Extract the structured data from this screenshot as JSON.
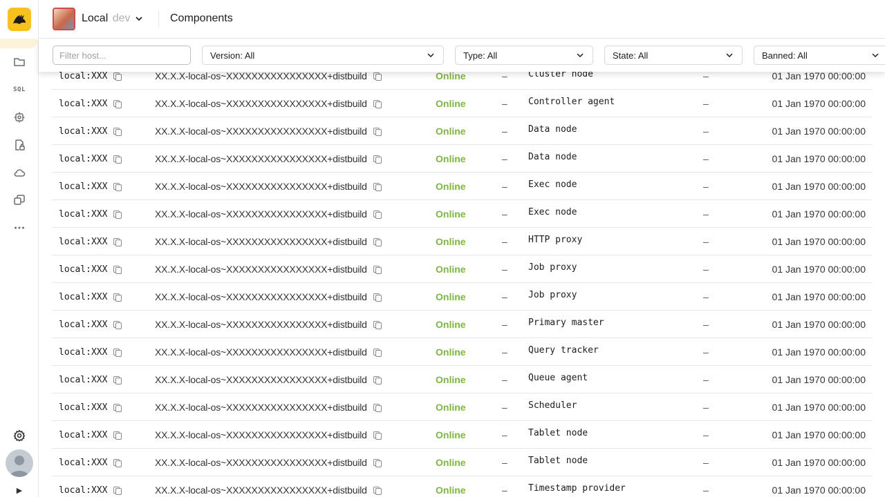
{
  "header": {
    "cluster_name": "Local",
    "cluster_env": "dev",
    "page_title": "Components"
  },
  "nav": {
    "sql_label": "SQL"
  },
  "filters": {
    "host_placeholder": "Filter host...",
    "version": "Version: All",
    "type": "Type: All",
    "state": "State: All",
    "banned": "Banned: All"
  },
  "colors": {
    "accent_logo": "#f7c21f",
    "state_online": "#7fb641"
  },
  "rows": [
    {
      "host": "local:XXX",
      "version": "XX.X.X-local-os~XXXXXXXXXXXXXXXX+distbuild",
      "state": "Online",
      "banned": "–",
      "type": "Cluster node",
      "extra": "–",
      "time": "01 Jan 1970 00:00:00"
    },
    {
      "host": "local:XXX",
      "version": "XX.X.X-local-os~XXXXXXXXXXXXXXXX+distbuild",
      "state": "Online",
      "banned": "–",
      "type": "Controller agent",
      "extra": "–",
      "time": "01 Jan 1970 00:00:00"
    },
    {
      "host": "local:XXX",
      "version": "XX.X.X-local-os~XXXXXXXXXXXXXXXX+distbuild",
      "state": "Online",
      "banned": "–",
      "type": "Data node",
      "extra": "–",
      "time": "01 Jan 1970 00:00:00"
    },
    {
      "host": "local:XXX",
      "version": "XX.X.X-local-os~XXXXXXXXXXXXXXXX+distbuild",
      "state": "Online",
      "banned": "–",
      "type": "Data node",
      "extra": "–",
      "time": "01 Jan 1970 00:00:00"
    },
    {
      "host": "local:XXX",
      "version": "XX.X.X-local-os~XXXXXXXXXXXXXXXX+distbuild",
      "state": "Online",
      "banned": "–",
      "type": "Exec node",
      "extra": "–",
      "time": "01 Jan 1970 00:00:00"
    },
    {
      "host": "local:XXX",
      "version": "XX.X.X-local-os~XXXXXXXXXXXXXXXX+distbuild",
      "state": "Online",
      "banned": "–",
      "type": "Exec node",
      "extra": "–",
      "time": "01 Jan 1970 00:00:00"
    },
    {
      "host": "local:XXX",
      "version": "XX.X.X-local-os~XXXXXXXXXXXXXXXX+distbuild",
      "state": "Online",
      "banned": "–",
      "type": "HTTP proxy",
      "extra": "–",
      "time": "01 Jan 1970 00:00:00"
    },
    {
      "host": "local:XXX",
      "version": "XX.X.X-local-os~XXXXXXXXXXXXXXXX+distbuild",
      "state": "Online",
      "banned": "–",
      "type": "Job proxy",
      "extra": "–",
      "time": "01 Jan 1970 00:00:00"
    },
    {
      "host": "local:XXX",
      "version": "XX.X.X-local-os~XXXXXXXXXXXXXXXX+distbuild",
      "state": "Online",
      "banned": "–",
      "type": "Job proxy",
      "extra": "–",
      "time": "01 Jan 1970 00:00:00"
    },
    {
      "host": "local:XXX",
      "version": "XX.X.X-local-os~XXXXXXXXXXXXXXXX+distbuild",
      "state": "Online",
      "banned": "–",
      "type": "Primary master",
      "extra": "–",
      "time": "01 Jan 1970 00:00:00"
    },
    {
      "host": "local:XXX",
      "version": "XX.X.X-local-os~XXXXXXXXXXXXXXXX+distbuild",
      "state": "Online",
      "banned": "–",
      "type": "Query tracker",
      "extra": "–",
      "time": "01 Jan 1970 00:00:00"
    },
    {
      "host": "local:XXX",
      "version": "XX.X.X-local-os~XXXXXXXXXXXXXXXX+distbuild",
      "state": "Online",
      "banned": "–",
      "type": "Queue agent",
      "extra": "–",
      "time": "01 Jan 1970 00:00:00"
    },
    {
      "host": "local:XXX",
      "version": "XX.X.X-local-os~XXXXXXXXXXXXXXXX+distbuild",
      "state": "Online",
      "banned": "–",
      "type": "Scheduler",
      "extra": "–",
      "time": "01 Jan 1970 00:00:00"
    },
    {
      "host": "local:XXX",
      "version": "XX.X.X-local-os~XXXXXXXXXXXXXXXX+distbuild",
      "state": "Online",
      "banned": "–",
      "type": "Tablet node",
      "extra": "–",
      "time": "01 Jan 1970 00:00:00"
    },
    {
      "host": "local:XXX",
      "version": "XX.X.X-local-os~XXXXXXXXXXXXXXXX+distbuild",
      "state": "Online",
      "banned": "–",
      "type": "Tablet node",
      "extra": "–",
      "time": "01 Jan 1970 00:00:00"
    },
    {
      "host": "local:XXX",
      "version": "XX.X.X-local-os~XXXXXXXXXXXXXXXX+distbuild",
      "state": "Online",
      "banned": "–",
      "type": "Timestamp provider",
      "extra": "–",
      "time": "01 Jan 1970 00:00:00"
    }
  ]
}
